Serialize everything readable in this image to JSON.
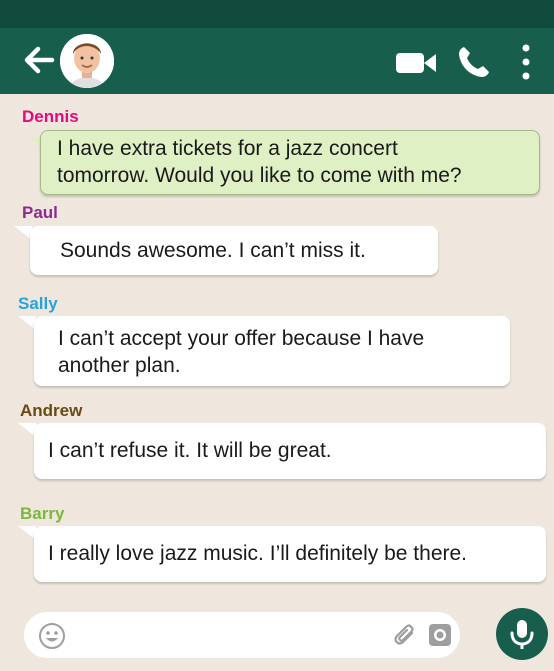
{
  "messages": [
    {
      "sender": "Dennis",
      "sender_color": "#e5087e",
      "lines": [
        "I have extra tickets for a jazz concert",
        "tomorrow. Would you like to come with me?"
      ],
      "direction": "outgoing"
    },
    {
      "sender": "Paul",
      "sender_color": "#8e2a8f",
      "lines": [
        "Sounds awesome. I can’t miss it."
      ],
      "direction": "incoming"
    },
    {
      "sender": "Sally",
      "sender_color": "#27a3dc",
      "lines": [
        "I can’t accept your offer because I have",
        "another plan."
      ],
      "direction": "incoming"
    },
    {
      "sender": "Andrew",
      "sender_color": "#6b4a12",
      "lines": [
        "I can’t refuse it. It will be great."
      ],
      "direction": "incoming"
    },
    {
      "sender": "Barry",
      "sender_color": "#7ab93c",
      "lines": [
        "I really love jazz music. I’ll definitely be there."
      ],
      "direction": "incoming"
    }
  ],
  "header": {
    "back_icon": "arrow-left-icon",
    "actions": [
      "video-camera-icon",
      "phone-icon",
      "more-vertical-icon"
    ]
  },
  "composer": {
    "icons": [
      "emoji-icon",
      "paperclip-icon",
      "camera-icon",
      "microphone-icon"
    ]
  },
  "colors": {
    "header": "#175e4d",
    "status_bar": "#0f4a3d",
    "background": "#efe7dd",
    "outgoing_bubble": "#dff0c4"
  }
}
